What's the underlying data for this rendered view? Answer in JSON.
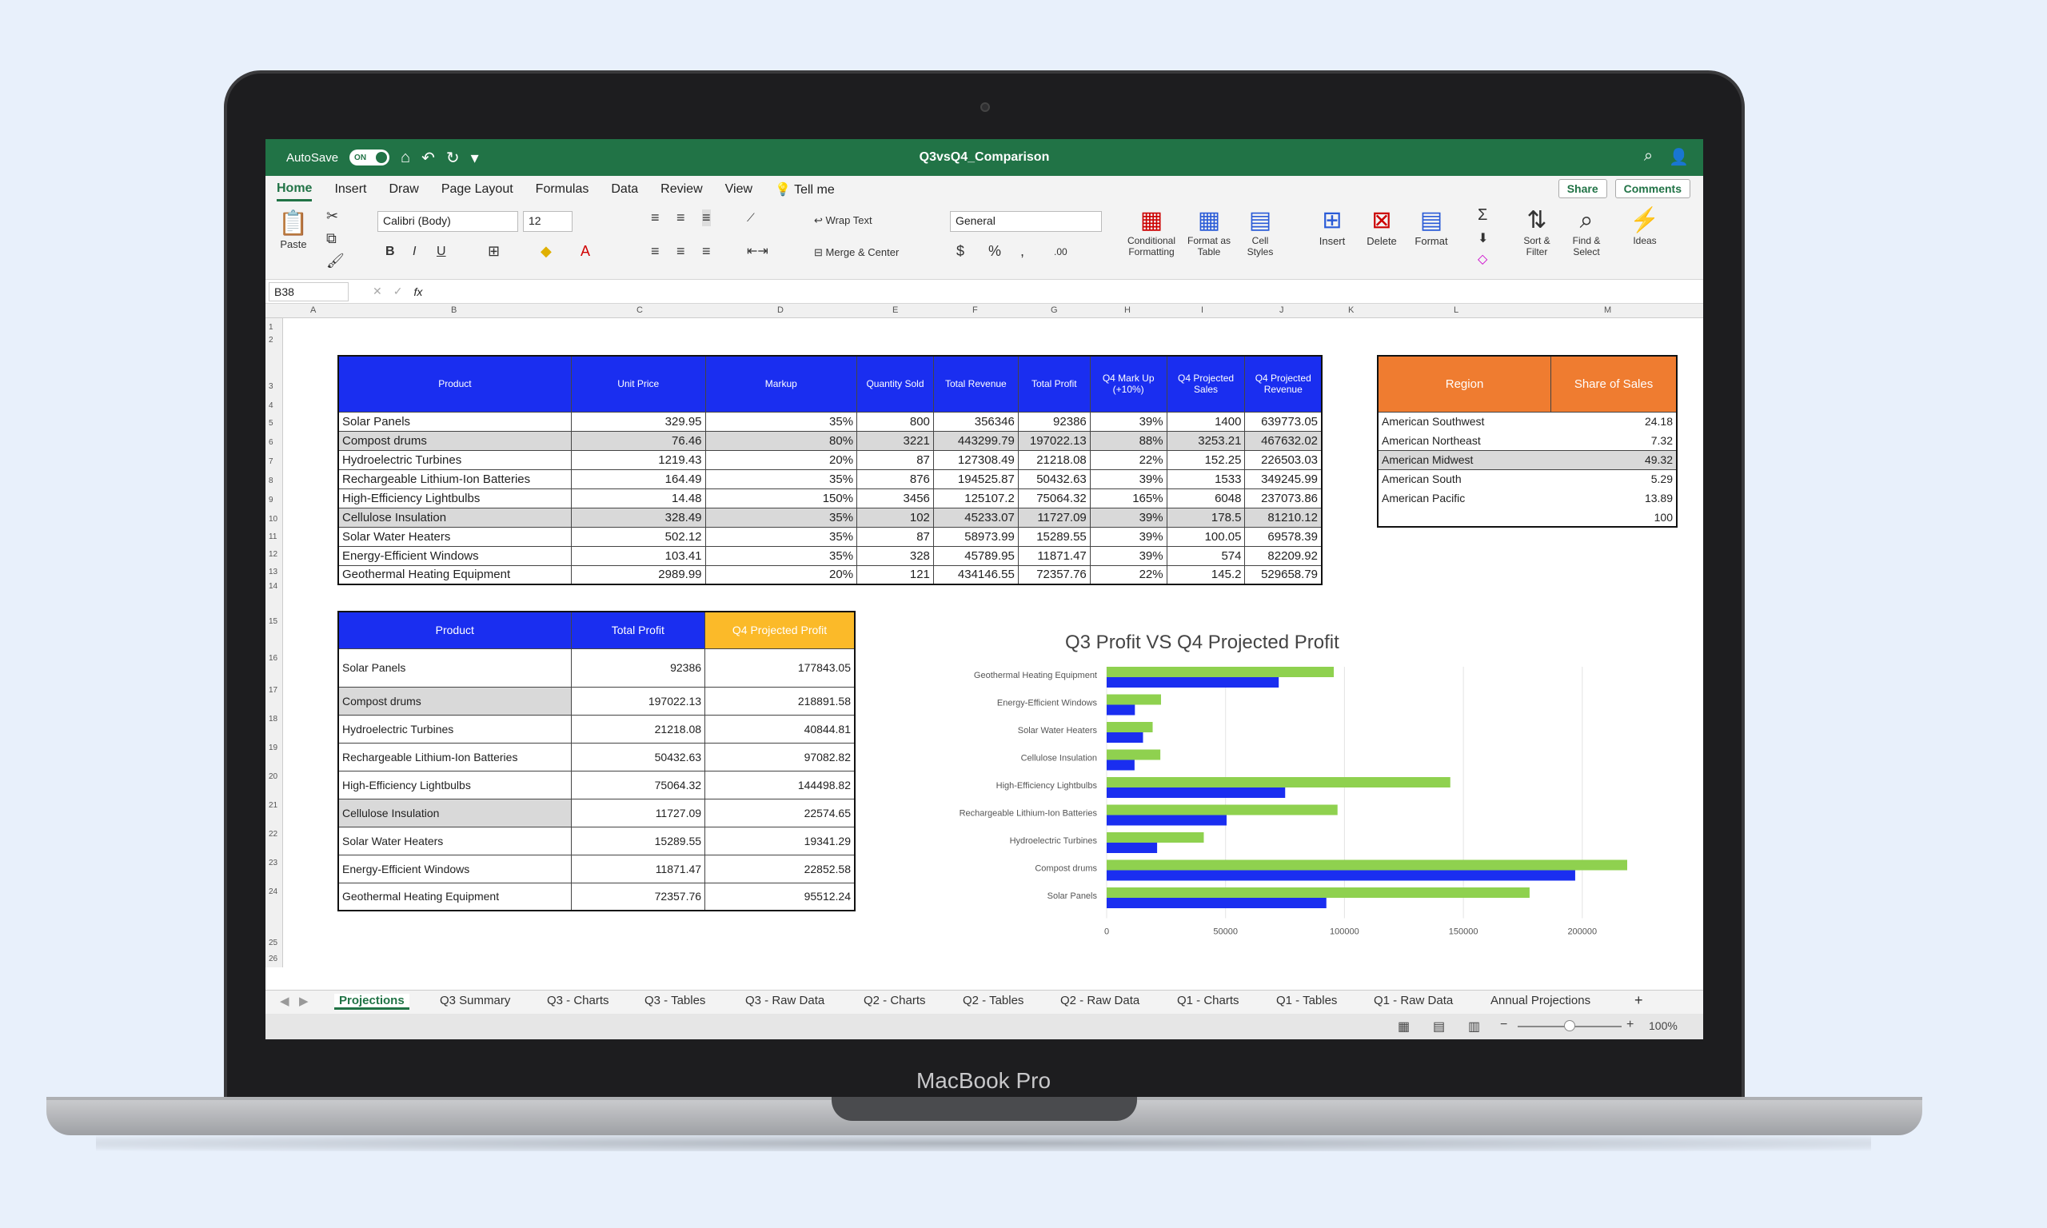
{
  "device": {
    "label": "MacBook Pro"
  },
  "titlebar": {
    "autosave": "AutoSave",
    "toggle": "ON",
    "title": "Q3vsQ4_Comparison"
  },
  "menu": {
    "tabs": [
      "Home",
      "Insert",
      "Draw",
      "Page Layout",
      "Formulas",
      "Data",
      "Review",
      "View",
      "Tell me"
    ],
    "share": "Share",
    "comments": "Comments"
  },
  "ribbon": {
    "paste": "Paste",
    "font": "Calibri (Body)",
    "size": "12",
    "wrap": "Wrap Text",
    "merge": "Merge & Center",
    "number_format": "General",
    "conditional": "Conditional Formatting",
    "format_table": "Format as Table",
    "cell_styles": "Cell Styles",
    "insert": "Insert",
    "delete": "Delete",
    "format": "Format",
    "sort": "Sort & Filter",
    "find": "Find & Select",
    "ideas": "Ideas"
  },
  "formula_bar": {
    "cell": "B38",
    "fx": "fx"
  },
  "columns": [
    "A",
    "B",
    "C",
    "D",
    "E",
    "F",
    "G",
    "H",
    "I",
    "J",
    "K",
    "L",
    "M"
  ],
  "rows": [
    "1",
    "2",
    "3",
    "4",
    "5",
    "6",
    "7",
    "8",
    "9",
    "10",
    "11",
    "12",
    "13",
    "14",
    "15",
    "16",
    "17",
    "18",
    "19",
    "20",
    "21",
    "22",
    "23",
    "24",
    "25",
    "26"
  ],
  "table1": {
    "headers": [
      "Product",
      "Unit Price",
      "Markup",
      "Quantity Sold",
      "Total Revenue",
      "Total Profit",
      "Q4 Mark Up (+10%)",
      "Q4 Projected Sales",
      "Q4 Projected Revenue"
    ],
    "rows": [
      [
        "Solar Panels",
        "329.95",
        "35%",
        "800",
        "356346",
        "92386",
        "39%",
        "1400",
        "639773.05"
      ],
      [
        "Compost drums",
        "76.46",
        "80%",
        "3221",
        "443299.79",
        "197022.13",
        "88%",
        "3253.21",
        "467632.02"
      ],
      [
        "Hydroelectric Turbines",
        "1219.43",
        "20%",
        "87",
        "127308.49",
        "21218.08",
        "22%",
        "152.25",
        "226503.03"
      ],
      [
        "Rechargeable Lithium-Ion Batteries",
        "164.49",
        "35%",
        "876",
        "194525.87",
        "50432.63",
        "39%",
        "1533",
        "349245.99"
      ],
      [
        "High-Efficiency Lightbulbs",
        "14.48",
        "150%",
        "3456",
        "125107.2",
        "75064.32",
        "165%",
        "6048",
        "237073.86"
      ],
      [
        "Cellulose Insulation",
        "328.49",
        "35%",
        "102",
        "45233.07",
        "11727.09",
        "39%",
        "178.5",
        "81210.12"
      ],
      [
        "Solar Water Heaters",
        "502.12",
        "35%",
        "87",
        "58973.99",
        "15289.55",
        "39%",
        "100.05",
        "69578.39"
      ],
      [
        "Energy-Efficient Windows",
        "103.41",
        "35%",
        "328",
        "45789.95",
        "11871.47",
        "39%",
        "574",
        "82209.92"
      ],
      [
        "Geothermal Heating Equipment",
        "2989.99",
        "20%",
        "121",
        "434146.55",
        "72357.76",
        "22%",
        "145.2",
        "529658.79"
      ]
    ]
  },
  "table2": {
    "headers": [
      "Product",
      "Total Profit",
      "Q4 Projected Profit"
    ],
    "rows": [
      [
        "Solar Panels",
        "92386",
        "177843.05"
      ],
      [
        "Compost drums",
        "197022.13",
        "218891.58"
      ],
      [
        "Hydroelectric Turbines",
        "21218.08",
        "40844.81"
      ],
      [
        "Rechargeable Lithium-Ion Batteries",
        "50432.63",
        "97082.82"
      ],
      [
        "High-Efficiency Lightbulbs",
        "75064.32",
        "144498.82"
      ],
      [
        "Cellulose Insulation",
        "11727.09",
        "22574.65"
      ],
      [
        "Solar Water Heaters",
        "15289.55",
        "19341.29"
      ],
      [
        "Energy-Efficient Windows",
        "11871.47",
        "22852.58"
      ],
      [
        "Geothermal Heating Equipment",
        "72357.76",
        "95512.24"
      ]
    ]
  },
  "table3": {
    "headers": [
      "Region",
      "Share of Sales"
    ],
    "rows": [
      [
        "American Southwest",
        "24.18"
      ],
      [
        "American Northeast",
        "7.32"
      ],
      [
        "American Midwest",
        "49.32"
      ],
      [
        "American South",
        "5.29"
      ],
      [
        "American Pacific",
        "13.89"
      ],
      [
        "",
        "100"
      ]
    ]
  },
  "chart_data": {
    "type": "bar",
    "title": "Q3 Profit VS Q4 Projected Profit",
    "categories": [
      "Geothermal Heating Equipment",
      "Energy-Efficient Windows",
      "Solar Water Heaters",
      "Cellulose Insulation",
      "High-Efficiency Lightbulbs",
      "Rechargeable Lithium-Ion Batteries",
      "Hydroelectric Turbines",
      "Compost drums",
      "Solar Panels"
    ],
    "series": [
      {
        "values": [
          95512.24,
          22852.58,
          19341.29,
          22574.65,
          144498.82,
          97082.82,
          40844.81,
          218891.58,
          177843.05
        ],
        "color": "#8fd14f"
      },
      {
        "values": [
          72357.76,
          11871.47,
          15289.55,
          11727.09,
          75064.32,
          50432.63,
          21218.08,
          197022.13,
          92386
        ],
        "color": "#1a2ef0"
      }
    ],
    "xticks": [
      "0",
      "50000",
      "100000",
      "150000",
      "200000"
    ],
    "xlim": [
      0,
      200000
    ]
  },
  "sheets": [
    "Projections",
    "Q3 Summary",
    "Q3 - Charts",
    "Q3 -  Tables",
    "Q3 - Raw Data",
    "Q2 - Charts",
    "Q2 - Tables",
    "Q2 - Raw Data",
    "Q1 - Charts",
    "Q1 - Tables",
    "Q1 - Raw Data",
    "Annual Projections",
    "+"
  ],
  "status": {
    "zoom": "100%"
  }
}
